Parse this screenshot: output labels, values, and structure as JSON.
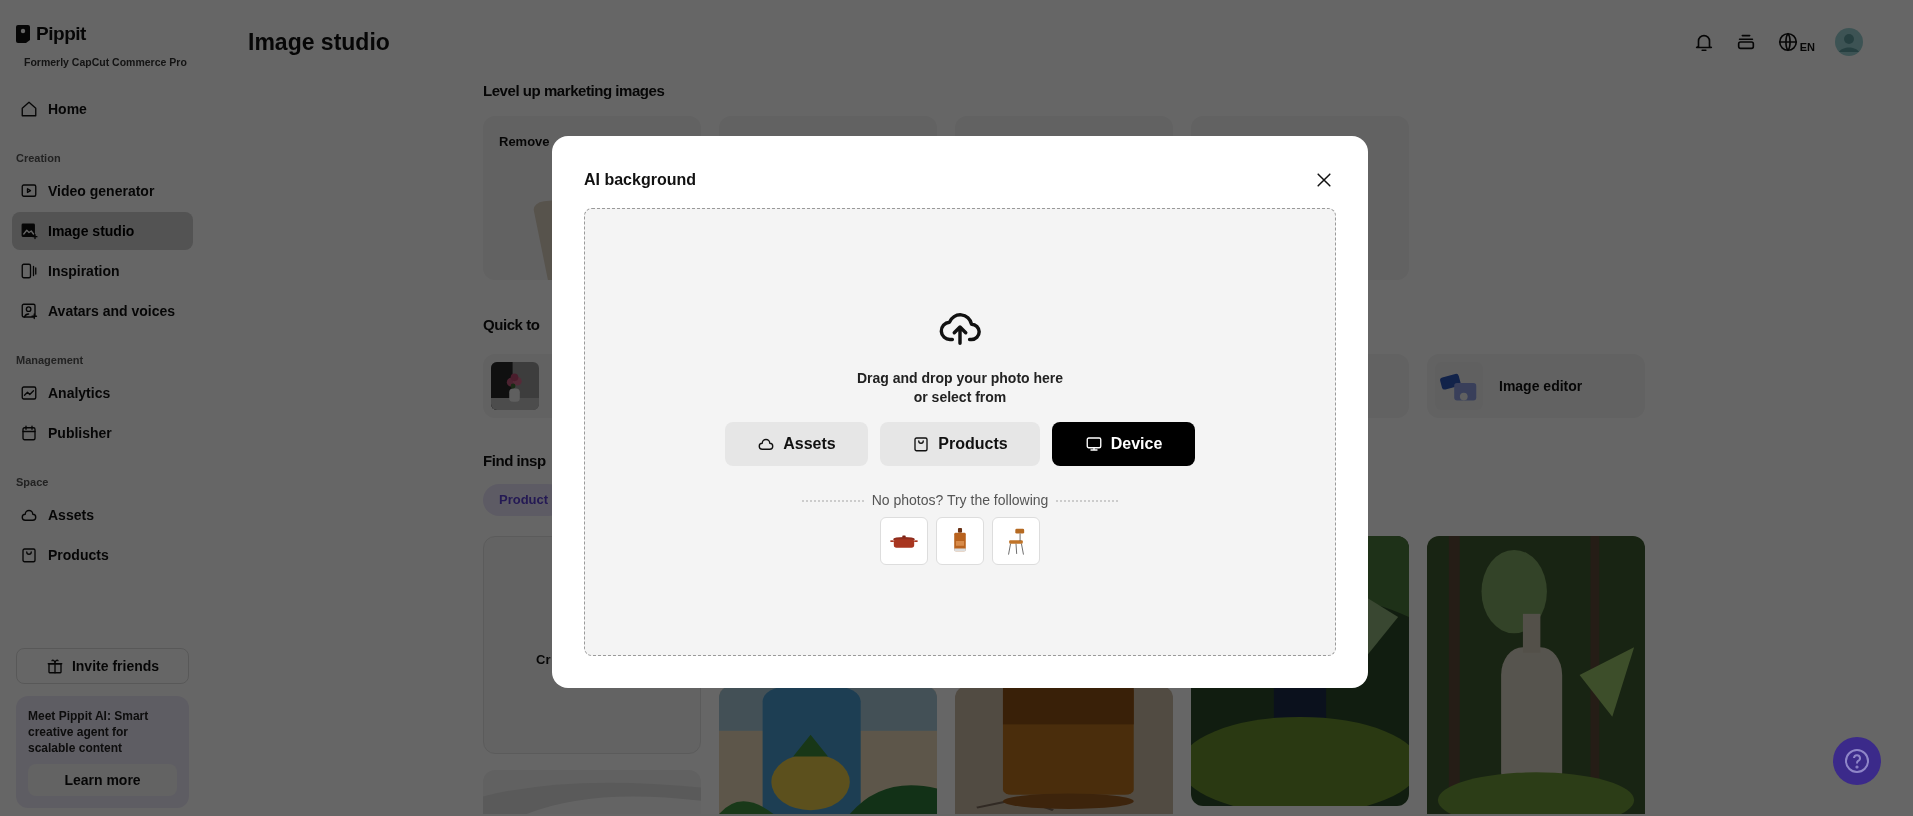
{
  "brand": {
    "name": "Pippit",
    "tagline": "Formerly CapCut Commerce Pro"
  },
  "header": {
    "title": "Image studio",
    "language": "EN"
  },
  "sidebar": {
    "top_items": [
      {
        "label": "Home",
        "selected": false
      }
    ],
    "sections": [
      {
        "title": "Creation",
        "items": [
          {
            "label": "Video generator",
            "selected": false
          },
          {
            "label": "Image studio",
            "selected": true
          },
          {
            "label": "Inspiration",
            "selected": false
          },
          {
            "label": "Avatars and voices",
            "selected": false
          }
        ]
      },
      {
        "title": "Management",
        "items": [
          {
            "label": "Analytics",
            "selected": false
          },
          {
            "label": "Publisher",
            "selected": false
          }
        ]
      },
      {
        "title": "Space",
        "items": [
          {
            "label": "Assets",
            "selected": false
          },
          {
            "label": "Products",
            "selected": false
          }
        ]
      }
    ],
    "invite_button": "Invite friends",
    "promo": {
      "text": "**Meet Pippit AI:** Smart creative agent for scalable content",
      "button": "Learn more"
    }
  },
  "level_up": {
    "title": "Level up marketing images",
    "cards": [
      {
        "kind": "labeled",
        "label": "Remove"
      },
      {
        "kind": "blank"
      },
      {
        "kind": "blank"
      },
      {
        "kind": "blank"
      }
    ]
  },
  "quick_tools": {
    "title": "Quick to",
    "cards": [
      {
        "kind": "thumb"
      },
      {
        "kind": "blank"
      },
      {
        "kind": "labeled",
        "label": "Image editor"
      }
    ]
  },
  "inspiration": {
    "title": "Find insp",
    "chip": {
      "label": "Product",
      "selected": true
    },
    "columns": [
      [
        {
          "kind": "text",
          "label": "Cr"
        },
        {
          "kind": "picture"
        }
      ],
      [
        {
          "kind": "picture"
        }
      ],
      [
        {
          "kind": "picture"
        }
      ],
      [
        {
          "kind": "picture"
        }
      ],
      [
        {
          "kind": "picture"
        }
      ]
    ]
  },
  "modal": {
    "title": "AI background",
    "drop_text": [
      "Drag and drop your photo here",
      "or select from"
    ],
    "buttons": [
      {
        "label": "Assets",
        "selected": false
      },
      {
        "label": "Products",
        "selected": false
      },
      {
        "label": "Device",
        "selected": true
      }
    ],
    "samples_label": "No photos? Try the following",
    "samples": [
      {
        "kind": "picture"
      },
      {
        "kind": "picture"
      },
      {
        "kind": "picture"
      }
    ]
  }
}
